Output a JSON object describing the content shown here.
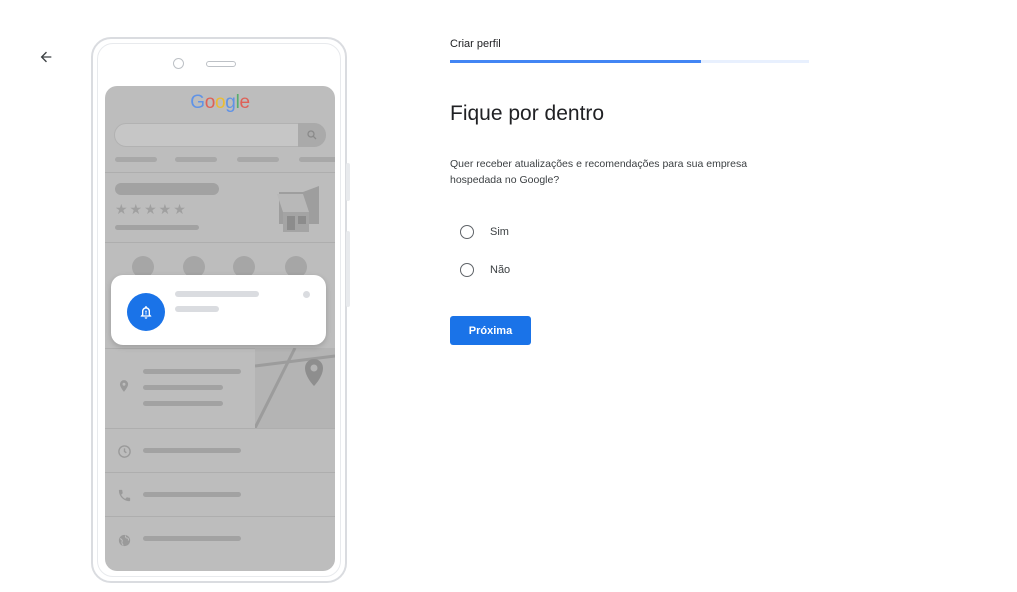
{
  "nav": {
    "back_icon": "arrow-back-icon"
  },
  "illustration": {
    "logo_letters": [
      {
        "char": "G",
        "color": "#4285F4"
      },
      {
        "char": "o",
        "color": "#EA4335"
      },
      {
        "char": "o",
        "color": "#FBBC05"
      },
      {
        "char": "g",
        "color": "#4285F4"
      },
      {
        "char": "l",
        "color": "#34A853"
      },
      {
        "char": "e",
        "color": "#EA4335"
      }
    ],
    "notification_icon": "bell-icon",
    "accent_color": "#1a73e8"
  },
  "progress": {
    "step_label": "Criar perfil",
    "fraction": 0.7
  },
  "form": {
    "title": "Fique por dentro",
    "question": "Quer receber atualizações e recomendações para sua empresa hospedada no Google?",
    "options": [
      {
        "label": "Sim",
        "selected": false
      },
      {
        "label": "Não",
        "selected": false
      }
    ],
    "next_label": "Próxima"
  }
}
